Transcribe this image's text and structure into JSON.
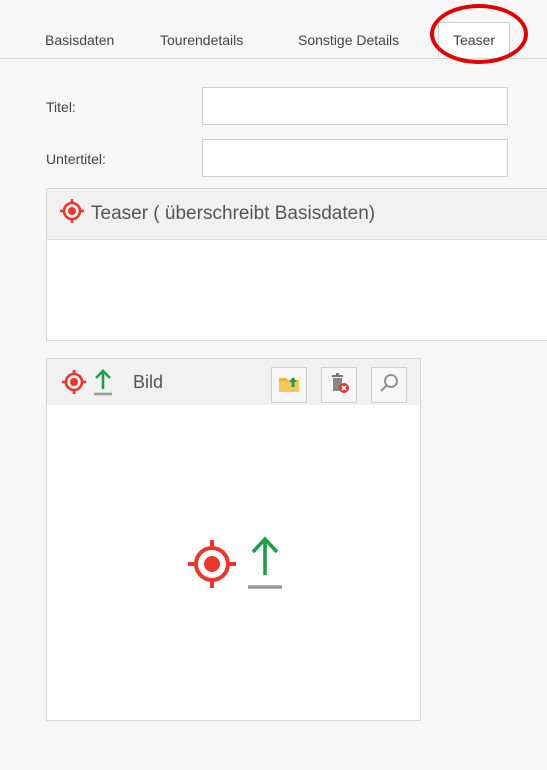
{
  "tabs": [
    {
      "label": "Basisdaten"
    },
    {
      "label": "Tourendetails"
    },
    {
      "label": "Sonstige Details"
    },
    {
      "label": "Teaser"
    }
  ],
  "form": {
    "title_label": "Titel:",
    "title_value": "",
    "subtitle_label": "Untertitel:",
    "subtitle_value": ""
  },
  "teaser_panel": {
    "title": "Teaser ( überschreibt Basisdaten)"
  },
  "image_panel": {
    "title": "Bild"
  },
  "colors": {
    "target_red": "#e8372c",
    "upload_green": "#1e9e4a",
    "highlight_ring": "#e00000"
  },
  "icons": [
    "target-icon",
    "upload-arrow-icon",
    "folder-upload-icon",
    "trash-delete-icon",
    "magnifier-icon"
  ]
}
